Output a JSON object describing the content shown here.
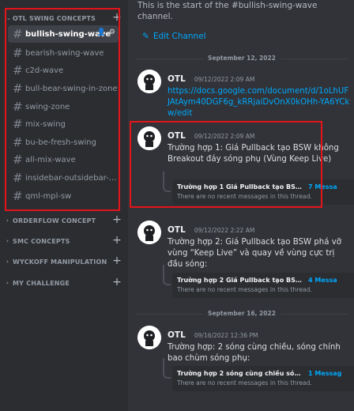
{
  "sidebar": {
    "categories": [
      {
        "label": "OTL SWING CONCEPTS",
        "expanded": true
      },
      {
        "label": "ORDERFLOW CONCEPT",
        "expanded": false
      },
      {
        "label": "SMC CONCEPTS",
        "expanded": false
      },
      {
        "label": "WYCKOFF MANIPULATION",
        "expanded": false
      },
      {
        "label": "MY CHALLENGE",
        "expanded": false
      }
    ],
    "channels": [
      {
        "label": "bullish-swing-wave",
        "active": true
      },
      {
        "label": "bearish-swing-wave"
      },
      {
        "label": "c2d-wave"
      },
      {
        "label": "bull-bear-swing-in-zone"
      },
      {
        "label": "swing-zone"
      },
      {
        "label": "mix-swing"
      },
      {
        "label": "bu-be-fresh-swing"
      },
      {
        "label": "all-mix-wave"
      },
      {
        "label": "insidebar-outsidebar-..."
      },
      {
        "label": "qml-mpl-sw"
      }
    ],
    "hash_icon": "#",
    "plus_icon": "+"
  },
  "main": {
    "intro_text": "This is the start of the #bullish-swing-wave channel.",
    "edit_channel": "Edit Channel",
    "dividers": [
      "September 12, 2022",
      "September 16, 2022"
    ],
    "messages": [
      {
        "author": "OTL",
        "timestamp": "09/12/2022 2:09 AM",
        "link": "https://docs.google.com/document/d/1oLhUFJAtAym40DGF6g_kRRjaiDvOnX0kOHh-YA6YCkw/edit"
      },
      {
        "author": "OTL",
        "timestamp": "09/12/2022 2:09 AM",
        "text": "Trường hợp 1: Giá Pullback tạo BSW không Breakout đáy sóng phụ (Vùng Keep Live)",
        "thread": {
          "name": "Trường hợp 1 Giá Pullback tạo BSW k...",
          "count": "7 Messa",
          "sub": "There are no recent messages in this thread."
        }
      },
      {
        "author": "OTL",
        "timestamp": "09/12/2022 2:22 AM",
        "text": "Trường hợp 2: Giá Pullback tạo BSW phá vỡ vùng “Keep Live” và quay về vùng cực trị đầu sóng:",
        "thread": {
          "name": "Trường hợp 2 Giá Pullback tạo BSW p...",
          "count": "4 Messa",
          "sub": "There are no recent messages in this thread."
        }
      },
      {
        "author": "OTL",
        "timestamp": "09/16/2022 12:36 PM",
        "text": "Trường hợp: 2 sóng cùng chiều, sóng chính bao chùm sóng phụ:",
        "thread": {
          "name": "Trường hợp 2 sóng cùng chiều sóng ...",
          "count": "1 Messag",
          "sub": "There are no recent messages in this thread."
        }
      }
    ]
  },
  "colors": {
    "accent_link": "#00a8fc",
    "highlight_box": "#e3141a",
    "sidebar_bg": "#2b2d31",
    "main_bg": "#313338"
  }
}
